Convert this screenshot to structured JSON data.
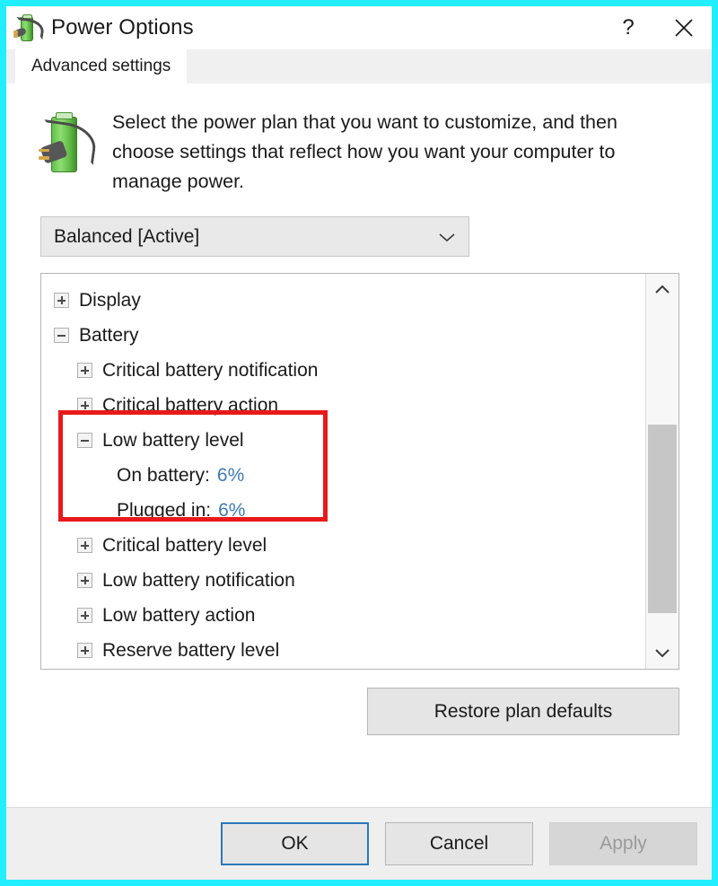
{
  "window": {
    "title": "Power Options",
    "icon": "power-battery-icon",
    "border_color": "#22EEFF",
    "help_label": "?",
    "close_label": "✕"
  },
  "tabs": [
    {
      "label": "Advanced settings",
      "active": true
    }
  ],
  "intro": {
    "icon": "power-battery-plug-icon",
    "text": "Select the power plan that you want to customize, and then choose settings that reflect how you want your computer to manage power."
  },
  "plan_select": {
    "value": "Balanced [Active]",
    "icon": "chevron-down-icon"
  },
  "tree": {
    "items": [
      {
        "level": 0,
        "state": "collapsed",
        "label": "Display"
      },
      {
        "level": 0,
        "state": "expanded",
        "label": "Battery"
      },
      {
        "level": 1,
        "state": "collapsed",
        "label": "Critical battery notification"
      },
      {
        "level": 1,
        "state": "collapsed",
        "label": "Critical battery action"
      },
      {
        "level": 1,
        "state": "expanded",
        "label": "Low battery level"
      },
      {
        "level": 2,
        "state": "leaf",
        "label": "On battery:",
        "value": "6%"
      },
      {
        "level": 2,
        "state": "leaf",
        "label": "Plugged in:",
        "value": "6%"
      },
      {
        "level": 1,
        "state": "collapsed",
        "label": "Critical battery level"
      },
      {
        "level": 1,
        "state": "collapsed",
        "label": "Low battery notification"
      },
      {
        "level": 1,
        "state": "collapsed",
        "label": "Low battery action"
      },
      {
        "level": 1,
        "state": "collapsed",
        "label": "Reserve battery level"
      }
    ],
    "value_color": "#3E7BB5",
    "highlight_color": "#E8191B",
    "scrollbar": {
      "up_icon": "chevron-up-icon",
      "down_icon": "chevron-down-icon"
    }
  },
  "buttons": {
    "restore": "Restore plan defaults",
    "ok": "OK",
    "cancel": "Cancel",
    "apply": "Apply"
  }
}
